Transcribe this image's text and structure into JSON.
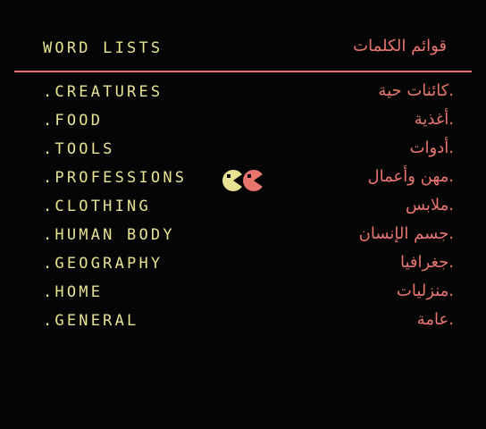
{
  "header": {
    "title_en": "WORD LISTS",
    "title_ar": "قوائم الكلمات"
  },
  "menu": {
    "selected_index": 3,
    "items": [
      {
        "en": ".CREATURES",
        "ar": ".كائنات حية"
      },
      {
        "en": ".FOOD",
        "ar": ".أغذية"
      },
      {
        "en": ".TOOLS",
        "ar": ".أدوات"
      },
      {
        "en": ".PROFESSIONS",
        "ar": ".مهن وأعمال"
      },
      {
        "en": ".CLOTHING",
        "ar": ".ملابس"
      },
      {
        "en": ".HUMAN BODY",
        "ar": ".جسم الإنسان"
      },
      {
        "en": ".GEOGRAPHY",
        "ar": ".جغرافيا"
      },
      {
        "en": ".HOME",
        "ar": ".منزليات"
      },
      {
        "en": ".GENERAL",
        "ar": ".عامة"
      }
    ]
  },
  "cursor": {
    "icon": "pacman-pair-icon",
    "left_color": "#e7e392",
    "right_color": "#e8766f"
  },
  "colors": {
    "background": "#050505",
    "english_text": "#e7e392",
    "arabic_text": "#e8766f",
    "divider": "#e8766f"
  }
}
